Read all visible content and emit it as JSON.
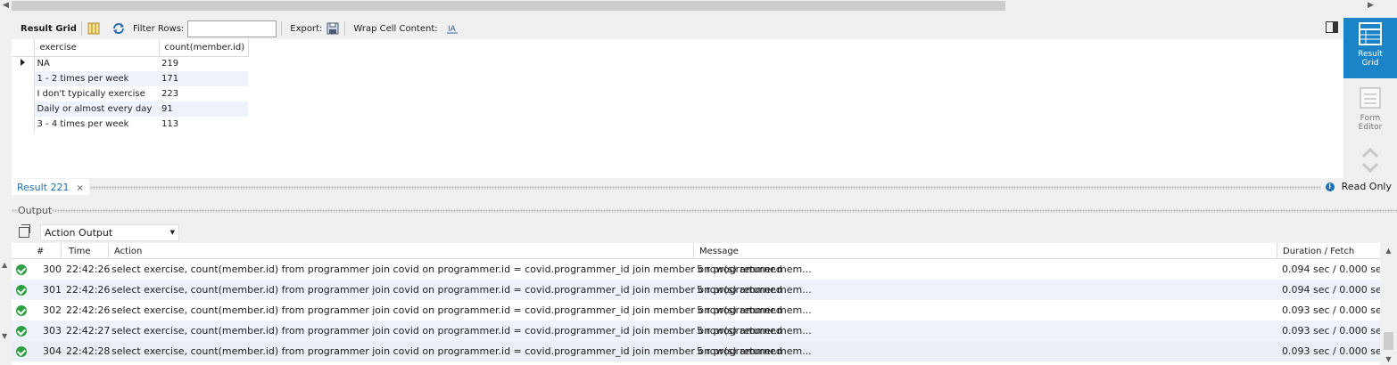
{
  "toolbar": {
    "result_grid_label": "Result Grid",
    "filter_rows_label": "Filter Rows:",
    "filter_value": "",
    "export_label": "Export:",
    "wrap_label": "Wrap Cell Content:"
  },
  "grid": {
    "columns": [
      "exercise",
      "count(member.id)"
    ],
    "rows": [
      {
        "exercise": "NA",
        "count": "219"
      },
      {
        "exercise": "1 - 2 times per week",
        "count": "171"
      },
      {
        "exercise": "I don't typically exercise",
        "count": "223"
      },
      {
        "exercise": "Daily or almost every day",
        "count": "91"
      },
      {
        "exercise": "3 - 4 times per week",
        "count": "113"
      }
    ]
  },
  "side_panel": {
    "result_grid": "Result Grid",
    "form_editor": "Form Editor"
  },
  "result_tab": {
    "label": "Result 221",
    "close": "×",
    "read_only": "Read Only"
  },
  "output": {
    "title": "Output",
    "selector": "Action Output",
    "columns": {
      "num": "#",
      "time": "Time",
      "action": "Action",
      "message": "Message",
      "duration": "Duration / Fetch"
    },
    "rows": [
      {
        "num": "300",
        "time": "22:42:26",
        "action": "select exercise, count(member.id) from programmer join covid on programmer.id = covid.programmer_id join member on programmer.mem...",
        "message": "5 row(s) returned",
        "duration": "0.094 sec / 0.000 sec"
      },
      {
        "num": "301",
        "time": "22:42:26",
        "action": "select exercise, count(member.id) from programmer join covid on programmer.id = covid.programmer_id join member on programmer.mem...",
        "message": "5 row(s) returned",
        "duration": "0.094 sec / 0.000 sec"
      },
      {
        "num": "302",
        "time": "22:42:26",
        "action": "select exercise, count(member.id) from programmer join covid on programmer.id = covid.programmer_id join member on programmer.mem...",
        "message": "5 row(s) returned",
        "duration": "0.093 sec / 0.000 sec"
      },
      {
        "num": "303",
        "time": "22:42:27",
        "action": "select exercise, count(member.id) from programmer join covid on programmer.id = covid.programmer_id join member on programmer.mem...",
        "message": "5 row(s) returned",
        "duration": "0.093 sec / 0.000 sec"
      },
      {
        "num": "304",
        "time": "22:42:28",
        "action": "select exercise, count(member.id) from programmer join covid on programmer.id = covid.programmer_id join member on programmer.mem...",
        "message": "5 row(s) returned",
        "duration": "0.093 sec / 0.000 sec"
      }
    ]
  },
  "colors": {
    "accent": "#1b84c7",
    "success": "#2ea043",
    "alt_row": "#eef3fb"
  }
}
